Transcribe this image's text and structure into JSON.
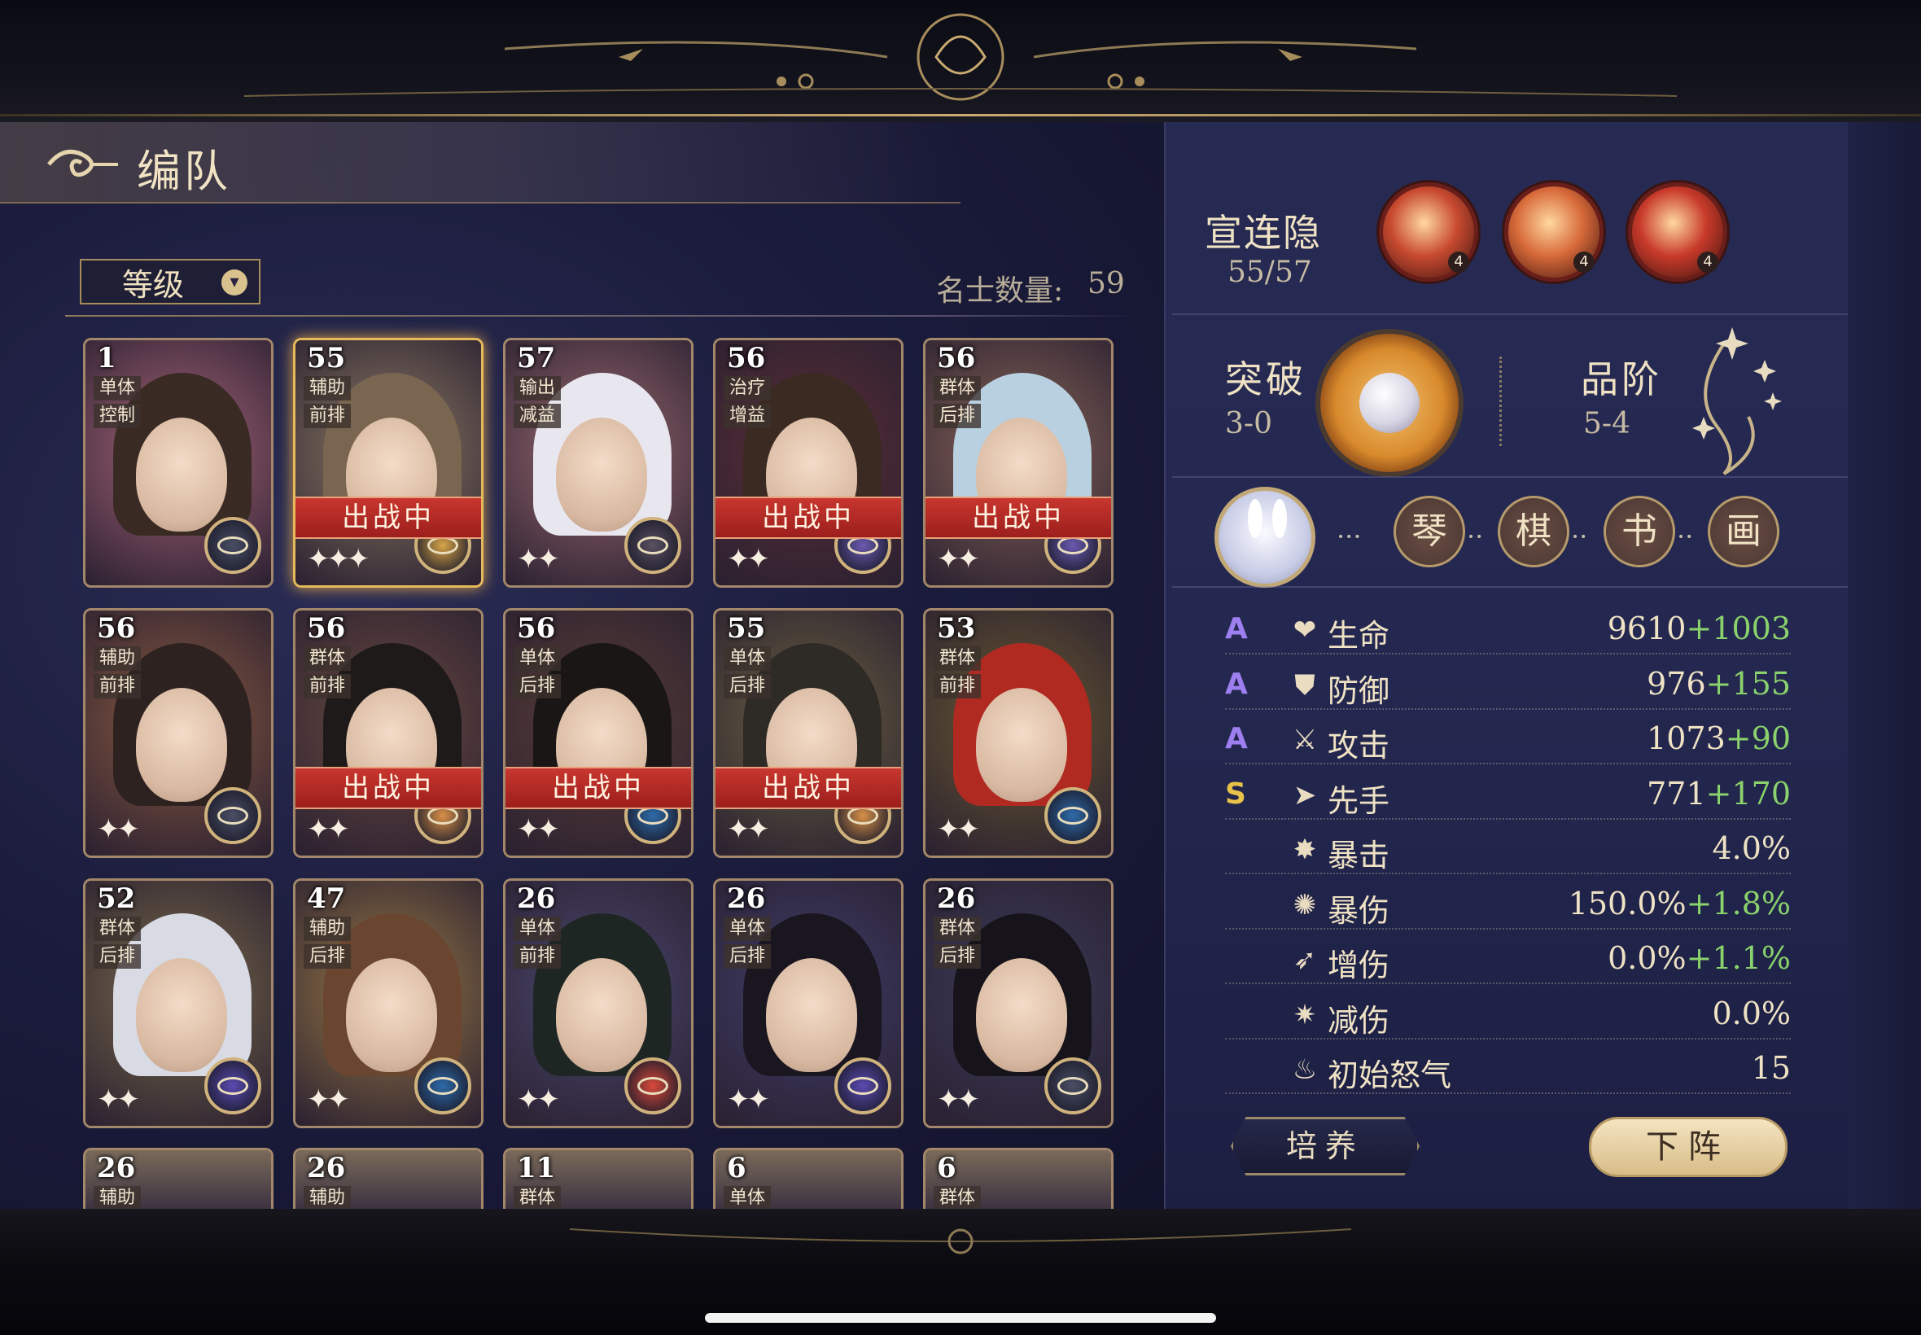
{
  "page": {
    "title": "编队"
  },
  "sort": {
    "label": "等级"
  },
  "roster": {
    "count_label": "名士数量:",
    "count_value": "59"
  },
  "cards": [
    {
      "level": "1",
      "tag1": "单体",
      "tag2": "控制",
      "deployed": "",
      "stars": "",
      "art": "#a8657a",
      "hair": "#3a2a24",
      "emblem": "#4a4e64"
    },
    {
      "level": "55",
      "tag1": "辅助",
      "tag2": "前排",
      "deployed": "出战中",
      "stars": "✦✦✦",
      "art": "#8c7a62",
      "hair": "#7a6650",
      "emblem": "#d8a448"
    },
    {
      "level": "57",
      "tag1": "输出",
      "tag2": "减益",
      "deployed": "",
      "stars": "✦✦",
      "art": "#9a6a70",
      "hair": "#e8e6ee",
      "emblem": "#5a5060"
    },
    {
      "level": "56",
      "tag1": "治疗",
      "tag2": "增益",
      "deployed": "出战中",
      "stars": "✦✦",
      "art": "#5a2e36",
      "hair": "#3a2a22",
      "emblem": "#6a5ab0"
    },
    {
      "level": "56",
      "tag1": "群体",
      "tag2": "后排",
      "deployed": "出战中",
      "stars": "✦✦",
      "art": "#8a6658",
      "hair": "#b8d0e0",
      "emblem": "#6a5ab0"
    },
    {
      "level": "56",
      "tag1": "辅助",
      "tag2": "前排",
      "deployed": "",
      "stars": "✦✦",
      "art": "#8a5a40",
      "hair": "#2e2220",
      "emblem": "#4a4e64"
    },
    {
      "level": "56",
      "tag1": "群体",
      "tag2": "前排",
      "deployed": "出战中",
      "stars": "✦✦",
      "art": "#6a4a40",
      "hair": "#1e1a1a",
      "emblem": "#d89048"
    },
    {
      "level": "56",
      "tag1": "单体",
      "tag2": "后排",
      "deployed": "出战中",
      "stars": "✦✦",
      "art": "#5a3e36",
      "hair": "#1a1616",
      "emblem": "#2e6aa8"
    },
    {
      "level": "55",
      "tag1": "单体",
      "tag2": "后排",
      "deployed": "出战中",
      "stars": "✦✦",
      "art": "#6a6040",
      "hair": "#2e2a26",
      "emblem": "#d89048"
    },
    {
      "level": "53",
      "tag1": "群体",
      "tag2": "前排",
      "deployed": "",
      "stars": "✦✦",
      "art": "#6a5a30",
      "hair": "#b02a22",
      "emblem": "#2e6aa8"
    },
    {
      "level": "52",
      "tag1": "群体",
      "tag2": "后排",
      "deployed": "",
      "stars": "✦✦",
      "art": "#7a6a4a",
      "hair": "#d8dae4",
      "emblem": "#5a4ab0"
    },
    {
      "level": "47",
      "tag1": "辅助",
      "tag2": "后排",
      "deployed": "",
      "stars": "✦✦",
      "art": "#9a7a46",
      "hair": "#6a4630",
      "emblem": "#2e6aa8"
    },
    {
      "level": "26",
      "tag1": "单体",
      "tag2": "前排",
      "deployed": "",
      "stars": "✦✦",
      "art": "#4a4870",
      "hair": "#1e2624",
      "emblem": "#d84a3a"
    },
    {
      "level": "26",
      "tag1": "单体",
      "tag2": "后排",
      "deployed": "",
      "stars": "✦✦",
      "art": "#3e3e6a",
      "hair": "#1a1620",
      "emblem": "#5a4ab0"
    },
    {
      "level": "26",
      "tag1": "群体",
      "tag2": "后排",
      "deployed": "",
      "stars": "✦✦",
      "art": "#3a3c5a",
      "hair": "#16141a",
      "emblem": "#4a4e64"
    }
  ],
  "partial_cards": [
    {
      "level": "26",
      "tag1": "辅助"
    },
    {
      "level": "26",
      "tag1": "辅助"
    },
    {
      "level": "11",
      "tag1": "群体"
    },
    {
      "level": "6",
      "tag1": "单体"
    },
    {
      "level": "6",
      "tag1": "群体"
    }
  ],
  "hero": {
    "name": "宣连隐",
    "level": "55/57",
    "skills": [
      {
        "icon": "claw-slash-icon",
        "badge": "4",
        "color": "#c84a30"
      },
      {
        "icon": "swirl-icon",
        "badge": "4",
        "color": "#d86a3a"
      },
      {
        "icon": "sun-burst-icon",
        "badge": "4",
        "color": "#c83a2a"
      }
    ],
    "breakthrough": {
      "label": "突破",
      "value": "3-0"
    },
    "grade": {
      "label": "品阶",
      "value": "5-4"
    },
    "arts": [
      "琴",
      "棋",
      "书",
      "画"
    ],
    "stats": [
      {
        "grade": "A",
        "grade_color": "#9e7ff0",
        "icon": "❤",
        "name": "生命",
        "base": "9610",
        "bonus": "+1003"
      },
      {
        "grade": "A",
        "grade_color": "#9e7ff0",
        "icon": "⛊",
        "name": "防御",
        "base": "976",
        "bonus": "+155"
      },
      {
        "grade": "A",
        "grade_color": "#9e7ff0",
        "icon": "⚔",
        "name": "攻击",
        "base": "1073",
        "bonus": "+90"
      },
      {
        "grade": "S",
        "grade_color": "#e8c34a",
        "icon": "➤",
        "name": "先手",
        "base": "771",
        "bonus": "+170"
      },
      {
        "grade": "",
        "grade_color": "#9e7ff0",
        "icon": "✸",
        "name": "暴击",
        "base": "4.0%",
        "bonus": ""
      },
      {
        "grade": "",
        "grade_color": "#9e7ff0",
        "icon": "✺",
        "name": "暴伤",
        "base": "150.0%",
        "bonus": "+1.8%"
      },
      {
        "grade": "",
        "grade_color": "#9e7ff0",
        "icon": "➶",
        "name": "增伤",
        "base": "0.0%",
        "bonus": "+1.1%"
      },
      {
        "grade": "",
        "grade_color": "#9e7ff0",
        "icon": "✷",
        "name": "减伤",
        "base": "0.0%",
        "bonus": ""
      },
      {
        "grade": "",
        "grade_color": "#9e7ff0",
        "icon": "♨",
        "name": "初始怒气",
        "base": "15",
        "bonus": ""
      }
    ],
    "buttons": {
      "train": "培养",
      "undeploy": "下阵"
    }
  }
}
